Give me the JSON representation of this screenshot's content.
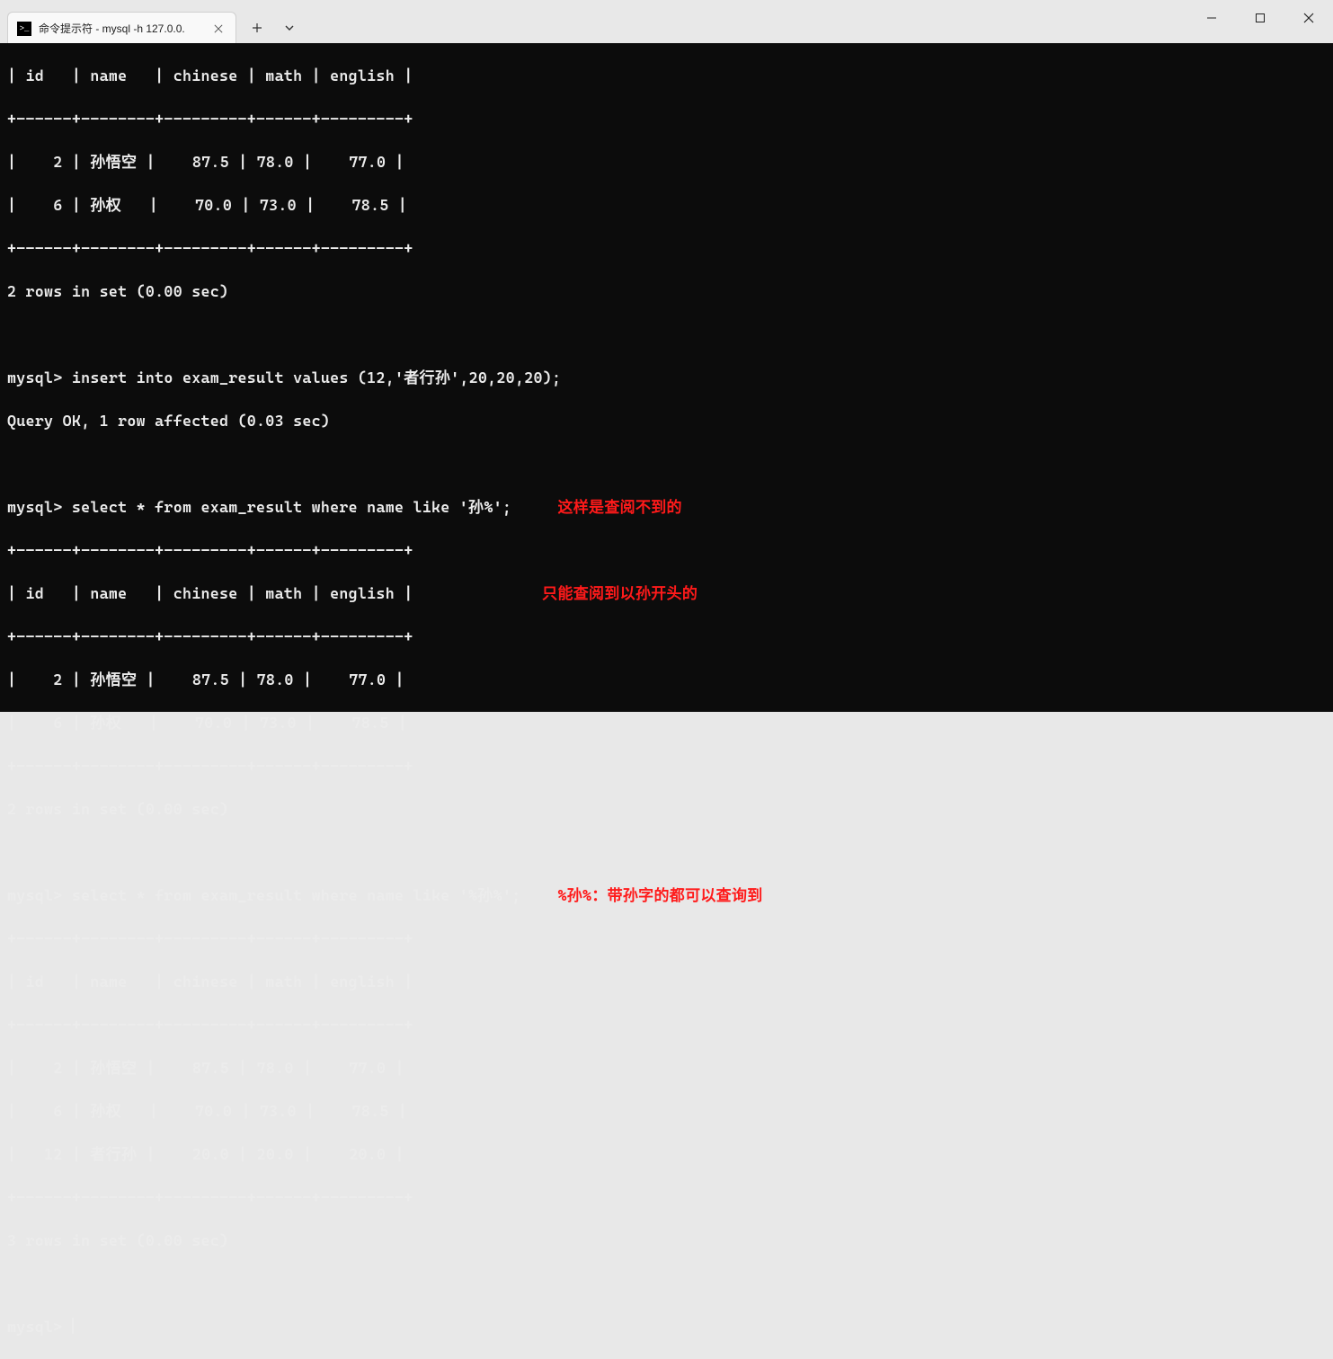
{
  "window": {
    "tab_title": "命令提示符 - mysql  -h 127.0.0."
  },
  "terminal": {
    "sep": "+------+--------+---------+------+---------+",
    "header": "| id   | name   | chinese | math | english |",
    "row_2": "|    2 | 孙悟空 |    87.5 | 78.0 |    77.0 |",
    "row_6": "|    6 | 孙权   |    70.0 | 73.0 |    78.5 |",
    "row_12": "|   12 | 者行孙 |    20.0 | 20.0 |    20.0 |",
    "rows2": "2 rows in set (0.00 sec)",
    "rows3": "3 rows in set (0.00 sec)",
    "prompt": "mysql> ",
    "insert_cmd": "insert into exam_result values (12,'者行孙',20,20,20);",
    "insert_ok": "Query OK, 1 row affected (0.03 sec)",
    "select1": "select * from exam_result where name like '孙%';",
    "select2": "select * from exam_result where name like '%孙%';",
    "anno1": "这样是查阅不到的",
    "anno2": "只能查阅到以孙开头的",
    "anno3": "%孙%：带孙字的都可以查询到"
  }
}
